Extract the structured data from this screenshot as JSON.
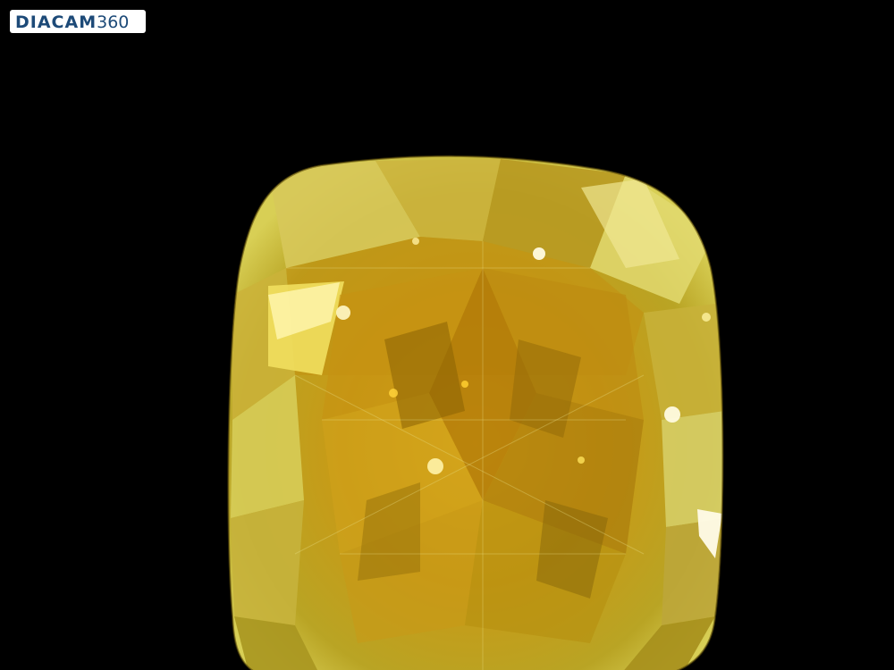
{
  "logo": {
    "brand": "DIACAM",
    "suffix": "360"
  },
  "colors": {
    "background": "#000000",
    "gem_primary": "#c9a81a",
    "gem_dark": "#7a5a06",
    "gem_light": "#f0e37a",
    "gem_highlight": "#fffbe0",
    "logo_text": "#1d4a78"
  },
  "subject": {
    "icon": "cushion-cut-yellow-diamond"
  }
}
